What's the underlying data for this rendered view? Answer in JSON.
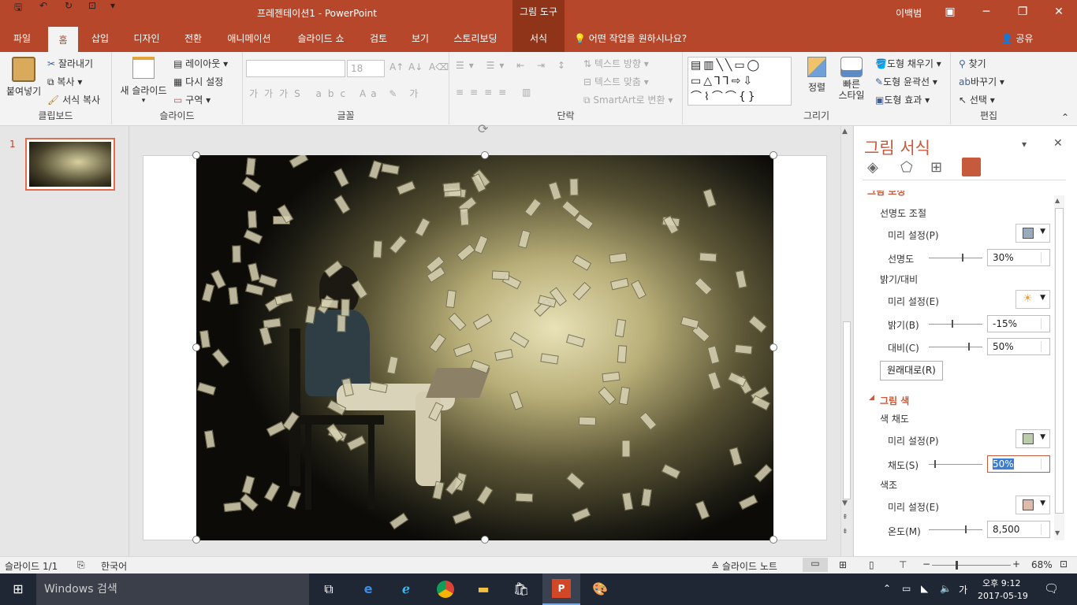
{
  "window": {
    "title": "프레젠테이션1  -  PowerPoint",
    "contextual_tab_head": "그림 도구",
    "user": "이백범"
  },
  "tabs": [
    "파일",
    "홈",
    "삽입",
    "디자인",
    "전환",
    "애니메이션",
    "슬라이드 쇼",
    "검토",
    "보기",
    "스토리보딩",
    "서식"
  ],
  "tell_me": "어떤 작업을 원하시나요?",
  "share": "공유",
  "ribbon": {
    "clipboard": {
      "paste": "붙여넣기",
      "cut": "잘라내기",
      "copy": "복사",
      "format_painter": "서식 복사",
      "label": "클립보드"
    },
    "slides": {
      "new_slide": "새 슬라이드",
      "layout": "레이아웃",
      "reset": "다시 설정",
      "section": "구역",
      "label": "슬라이드"
    },
    "font": {
      "size_value": "18",
      "label": "글꼴"
    },
    "paragraph": {
      "text_direction": "텍스트 방향",
      "align_text": "텍스트 맞춤",
      "smartart": "SmartArt로 변환",
      "label": "단락"
    },
    "drawing": {
      "arrange": "정렬",
      "quick_styles": "빠른\n스타일",
      "shape_fill": "도형 채우기",
      "shape_outline": "도형 윤곽선",
      "shape_effects": "도형 효과",
      "label": "그리기"
    },
    "editing": {
      "find": "찾기",
      "replace": "바꾸기",
      "select": "선택",
      "label": "편집"
    }
  },
  "slide_panel": {
    "number": "1"
  },
  "format_pane": {
    "title": "그림 서식",
    "partial_header": "그림 보정",
    "sharpness_header": "선명도 조절",
    "preset_p": "미리 설정(P)",
    "sharpness_label": "선명도",
    "sharpness_value": "30%",
    "brightness_contrast_header": "밝기/대비",
    "preset_e": "미리 설정(E)",
    "brightness_label": "밝기(B)",
    "brightness_value": "-15%",
    "contrast_label": "대비(C)",
    "contrast_value": "50%",
    "reset_button": "원래대로(R)",
    "picture_color_header": "그림 색",
    "saturation_header": "색 채도",
    "preset_p2": "미리 설정(P)",
    "saturation_label": "채도(S)",
    "saturation_value": "50%",
    "tone_header": "색조",
    "preset_e2": "미리 설정(E)",
    "temperature_label": "온도(M)",
    "temperature_value": "8,500"
  },
  "status": {
    "slide_info": "슬라이드 1/1",
    "language": "한국어",
    "notes": "슬라이드 노트",
    "zoom": "68%"
  },
  "taskbar": {
    "search_placeholder": "Windows 검색",
    "ime": "가",
    "time": "오후 9:12",
    "date": "2017-05-19"
  },
  "colors": {
    "accent": "#b7472a",
    "pane_title": "#c55a3c"
  }
}
